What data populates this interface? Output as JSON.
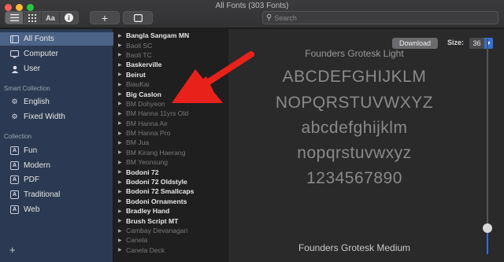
{
  "window": {
    "title": "All Fonts (303 Fonts)"
  },
  "toolbar": {
    "search_placeholder": "Search",
    "add_label": "+",
    "view_icons": [
      "list-icon",
      "grid-icon",
      "text-size-icon",
      "info-icon"
    ]
  },
  "sidebar": {
    "items_top": [
      {
        "label": "All Fonts",
        "icon": "book-icon",
        "selected": true
      },
      {
        "label": "Computer",
        "icon": "monitor-icon"
      },
      {
        "label": "User",
        "icon": "user-icon"
      }
    ],
    "smart_collection_header": "Smart Collection",
    "smart_items": [
      {
        "label": "English",
        "icon": "gear-icon"
      },
      {
        "label": "Fixed Width",
        "icon": "gear-icon"
      }
    ],
    "collection_header": "Collection",
    "collection_items": [
      {
        "label": "Fun",
        "icon": "font-box-icon"
      },
      {
        "label": "Modern",
        "icon": "font-box-icon"
      },
      {
        "label": "PDF",
        "icon": "font-box-icon"
      },
      {
        "label": "Traditional",
        "icon": "font-box-icon"
      },
      {
        "label": "Web",
        "icon": "font-box-icon"
      }
    ],
    "add_label": "+"
  },
  "font_list": [
    {
      "name": "Bangla Sangam MN",
      "enabled": true
    },
    {
      "name": "Baoli SC",
      "enabled": false
    },
    {
      "name": "Baoli TC",
      "enabled": false
    },
    {
      "name": "Baskerville",
      "enabled": true
    },
    {
      "name": "Beirut",
      "enabled": true
    },
    {
      "name": "BiauKai",
      "enabled": false
    },
    {
      "name": "Big Caslon",
      "enabled": true
    },
    {
      "name": "BM Dohyeon",
      "enabled": false
    },
    {
      "name": "BM Hanna 11yrs Old",
      "enabled": false
    },
    {
      "name": "BM Hanna Air",
      "enabled": false
    },
    {
      "name": "BM Hanna Pro",
      "enabled": false
    },
    {
      "name": "BM Jua",
      "enabled": false
    },
    {
      "name": "BM Kirang Haerang",
      "enabled": false
    },
    {
      "name": "BM Yeonsung",
      "enabled": false
    },
    {
      "name": "Bodoni 72",
      "enabled": true
    },
    {
      "name": "Bodoni 72 Oldstyle",
      "enabled": true
    },
    {
      "name": "Bodoni 72 Smallcaps",
      "enabled": true
    },
    {
      "name": "Bodoni Ornaments",
      "enabled": true
    },
    {
      "name": "Bradley Hand",
      "enabled": true
    },
    {
      "name": "Brush Script MT",
      "enabled": true
    },
    {
      "name": "Cambay Devanagari",
      "enabled": false
    },
    {
      "name": "Canela",
      "enabled": false
    },
    {
      "name": "Canela Deck",
      "enabled": false
    }
  ],
  "preview": {
    "download_label": "Download",
    "size_label": "Size:",
    "size_value": "36",
    "font_name_top": "Founders Grotesk Light",
    "uppercase_1": "ABCDEFGHIJKLM",
    "uppercase_2": "NOPQRSTUVWXYZ",
    "lowercase_1": "abcdefghijklm",
    "lowercase_2": "nopqrstuvwxyz",
    "digits": "1234567890",
    "font_name_bottom": "Founders Grotesk Medium"
  },
  "colors": {
    "annotation_arrow": "#e8221b",
    "accent": "#2f6fe0",
    "sidebar_bg": "#2b3a52"
  }
}
